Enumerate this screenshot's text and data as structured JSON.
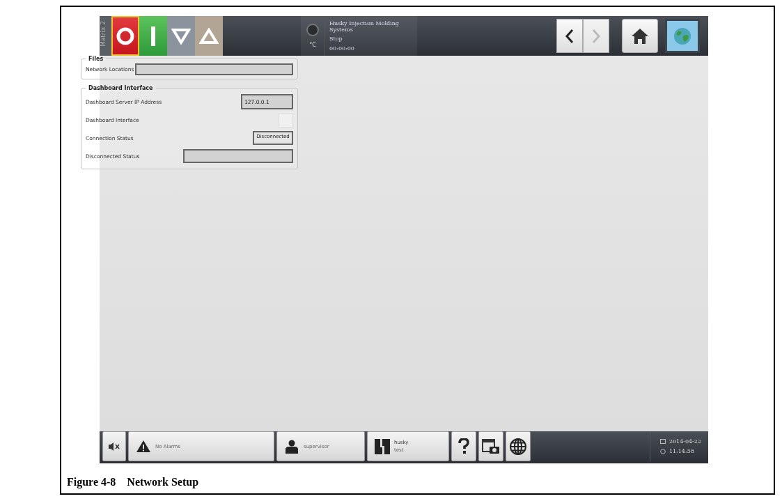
{
  "top_bar": {
    "side_label": "Matrix 2",
    "mode_buttons": [
      {
        "kind": "stop",
        "selected": true
      },
      {
        "kind": "start",
        "selected": false
      },
      {
        "kind": "down",
        "selected": false
      },
      {
        "kind": "up",
        "selected": false
      }
    ],
    "status": {
      "unit": "°C",
      "machine": "Husky Injection Molding Systems",
      "state": "Stop",
      "timer": "00:00:00"
    },
    "nav": [
      {
        "kind": "back",
        "disabled": false
      },
      {
        "kind": "forward",
        "disabled": true
      }
    ]
  },
  "files": {
    "title": "Files",
    "fields": [
      {
        "label": "Network Locations"
      }
    ]
  },
  "dashboard": {
    "title": "Dashboard Interface",
    "rows": [
      {
        "kind": "field",
        "label": "Dashboard Server IP Address",
        "value": "127.0.0.1"
      },
      {
        "kind": "checkbox",
        "label": "Dashboard Interface",
        "checked": false
      },
      {
        "kind": "status",
        "label": "Connection Status",
        "value": "Disconnected"
      },
      {
        "kind": "wide",
        "label": "Disconnected Status"
      }
    ]
  },
  "bottom_bar": {
    "alarms": "No Alarms",
    "user": "supervisor",
    "profile": {
      "name": "husky",
      "sub": "test"
    },
    "date": "2014-04-22",
    "time": "11:14:58"
  },
  "caption": {
    "number": "Figure 4-8",
    "title": "Network Setup"
  }
}
